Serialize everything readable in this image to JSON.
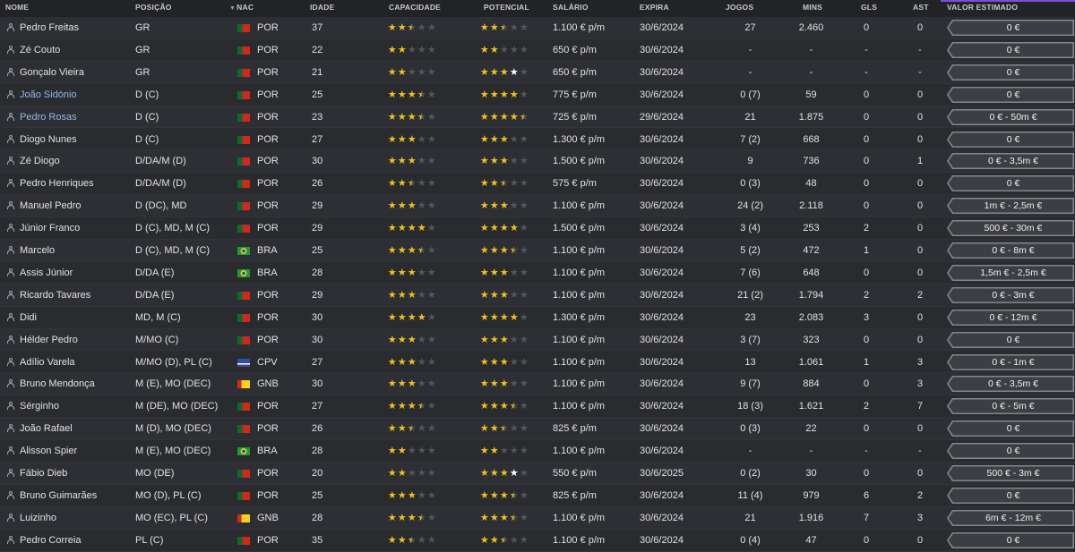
{
  "columns": {
    "name": "NOME",
    "position": "POSIÇÃO",
    "nationality": "NAC",
    "age": "IDADE",
    "ability": "CAPACIDADE",
    "potential": "POTENCIAL",
    "wage": "SALÁRIO",
    "expires": "EXPIRA",
    "games": "JOGOS",
    "minutes": "MINS",
    "goals": "GLS",
    "assists": "AST",
    "estimated_value": "VALOR ESTIMADO"
  },
  "sort_icon": "triangle-down-icon",
  "colors": {
    "star": "#f2c21b",
    "star_empty": "#55565b",
    "highlight_name": "#8fb8e6",
    "header_accent": "#7a4dd6"
  },
  "flags": {
    "POR": [
      "#0b6b2e",
      "#d3261c"
    ],
    "BRA": [
      "#1a9a3a",
      "#f5d21c"
    ],
    "CPV": [
      "#2a4fa6",
      "#ffffff"
    ],
    "GNB": [
      "#d3261c",
      "#f5d21c"
    ]
  },
  "players": [
    {
      "name": "Pedro Freitas",
      "position": "GR",
      "nat": "POR",
      "age": "37",
      "ability": 2.5,
      "potential": 2.5,
      "potential_white": 0,
      "wage": "1.100 € p/m",
      "expires": "30/6/2024",
      "games": "27",
      "mins": "2.460",
      "goals": "0",
      "assists": "0",
      "value": "0 €",
      "highlight": false
    },
    {
      "name": "Zé Couto",
      "position": "GR",
      "nat": "POR",
      "age": "22",
      "ability": 2,
      "potential": 2,
      "potential_white": 0,
      "wage": "650 € p/m",
      "expires": "30/6/2024",
      "games": "-",
      "mins": "-",
      "goals": "-",
      "assists": "-",
      "value": "0 €",
      "highlight": false
    },
    {
      "name": "Gonçalo Vieira",
      "position": "GR",
      "nat": "POR",
      "age": "21",
      "ability": 2,
      "potential": 3,
      "potential_white": 1,
      "wage": "650 € p/m",
      "expires": "30/6/2024",
      "games": "-",
      "mins": "-",
      "goals": "-",
      "assists": "-",
      "value": "0 €",
      "highlight": false
    },
    {
      "name": "João Sidónio",
      "position": "D (C)",
      "nat": "POR",
      "age": "25",
      "ability": 3.5,
      "potential": 4,
      "potential_white": 0,
      "wage": "775 € p/m",
      "expires": "30/6/2024",
      "games": "0 (7)",
      "mins": "59",
      "goals": "0",
      "assists": "0",
      "value": "0 €",
      "highlight": true
    },
    {
      "name": "Pedro Rosas",
      "position": "D (C)",
      "nat": "POR",
      "age": "23",
      "ability": 3.5,
      "potential": 4.5,
      "potential_white": 0,
      "wage": "725 € p/m",
      "expires": "29/6/2024",
      "games": "21",
      "mins": "1.875",
      "goals": "0",
      "assists": "0",
      "value": "0 € - 50m €",
      "highlight": true
    },
    {
      "name": "Diogo Nunes",
      "position": "D (C)",
      "nat": "POR",
      "age": "27",
      "ability": 3,
      "potential": 3,
      "potential_white": 0,
      "wage": "1.300 € p/m",
      "expires": "30/6/2024",
      "games": "7 (2)",
      "mins": "668",
      "goals": "0",
      "assists": "0",
      "value": "0 €",
      "highlight": false
    },
    {
      "name": "Zé Diogo",
      "position": "D/DA/M (D)",
      "nat": "POR",
      "age": "30",
      "ability": 3,
      "potential": 3,
      "potential_white": 0,
      "wage": "1.500 € p/m",
      "expires": "30/6/2024",
      "games": "9",
      "mins": "736",
      "goals": "0",
      "assists": "1",
      "value": "0 € - 3,5m €",
      "highlight": false
    },
    {
      "name": "Pedro Henriques",
      "position": "D/DA/M (D)",
      "nat": "POR",
      "age": "26",
      "ability": 2.5,
      "potential": 2.5,
      "potential_white": 0,
      "wage": "575 € p/m",
      "expires": "30/6/2024",
      "games": "0 (3)",
      "mins": "48",
      "goals": "0",
      "assists": "0",
      "value": "0 €",
      "highlight": false
    },
    {
      "name": "Manuel Pedro",
      "position": "D (DC), MD",
      "nat": "POR",
      "age": "29",
      "ability": 3,
      "potential": 3,
      "potential_white": 0,
      "wage": "1.100 € p/m",
      "expires": "30/6/2024",
      "games": "24 (2)",
      "mins": "2.118",
      "goals": "0",
      "assists": "0",
      "value": "1m € - 2,5m €",
      "highlight": false
    },
    {
      "name": "Júnior Franco",
      "position": "D (C), MD, M (C)",
      "nat": "POR",
      "age": "29",
      "ability": 4,
      "potential": 4,
      "potential_white": 0,
      "wage": "1.500 € p/m",
      "expires": "30/6/2024",
      "games": "3 (4)",
      "mins": "253",
      "goals": "2",
      "assists": "0",
      "value": "500 € - 30m €",
      "highlight": false
    },
    {
      "name": "Marcelo",
      "position": "D (C), MD, M (C)",
      "nat": "BRA",
      "age": "25",
      "ability": 3.5,
      "potential": 3.5,
      "potential_white": 0,
      "wage": "1.100 € p/m",
      "expires": "30/6/2024",
      "games": "5 (2)",
      "mins": "472",
      "goals": "1",
      "assists": "0",
      "value": "0 € - 8m €",
      "highlight": false
    },
    {
      "name": "Assis Júnior",
      "position": "D/DA (E)",
      "nat": "BRA",
      "age": "28",
      "ability": 3,
      "potential": 3,
      "potential_white": 0,
      "wage": "1.100 € p/m",
      "expires": "30/6/2024",
      "games": "7 (6)",
      "mins": "648",
      "goals": "0",
      "assists": "0",
      "value": "1,5m € - 2,5m €",
      "highlight": false
    },
    {
      "name": "Ricardo Tavares",
      "position": "D/DA (E)",
      "nat": "POR",
      "age": "29",
      "ability": 3,
      "potential": 3,
      "potential_white": 0,
      "wage": "1.100 € p/m",
      "expires": "30/6/2024",
      "games": "21 (2)",
      "mins": "1.794",
      "goals": "2",
      "assists": "2",
      "value": "0 € - 3m €",
      "highlight": false
    },
    {
      "name": "Didi",
      "position": "MD, M (C)",
      "nat": "POR",
      "age": "30",
      "ability": 4,
      "potential": 4,
      "potential_white": 0,
      "wage": "1.300 € p/m",
      "expires": "30/6/2024",
      "games": "23",
      "mins": "2.083",
      "goals": "3",
      "assists": "0",
      "value": "0 € - 12m €",
      "highlight": false
    },
    {
      "name": "Hélder Pedro",
      "position": "M/MO (C)",
      "nat": "POR",
      "age": "30",
      "ability": 3,
      "potential": 3,
      "potential_white": 0,
      "wage": "1.100 € p/m",
      "expires": "30/6/2024",
      "games": "3 (7)",
      "mins": "323",
      "goals": "0",
      "assists": "0",
      "value": "0 €",
      "highlight": false
    },
    {
      "name": "Adílio Varela",
      "position": "M/MO (D), PL (C)",
      "nat": "CPV",
      "age": "27",
      "ability": 3,
      "potential": 3,
      "potential_white": 0,
      "wage": "1.100 € p/m",
      "expires": "30/6/2024",
      "games": "13",
      "mins": "1.061",
      "goals": "1",
      "assists": "3",
      "value": "0 € - 1m €",
      "highlight": false
    },
    {
      "name": "Bruno Mendonça",
      "position": "M (E), MO (DEC)",
      "nat": "GNB",
      "age": "30",
      "ability": 3,
      "potential": 3,
      "potential_white": 0,
      "wage": "1.100 € p/m",
      "expires": "30/6/2024",
      "games": "9 (7)",
      "mins": "884",
      "goals": "0",
      "assists": "3",
      "value": "0 € - 3,5m €",
      "highlight": false
    },
    {
      "name": "Sérginho",
      "position": "M (DE), MO (DEC)",
      "nat": "POR",
      "age": "27",
      "ability": 3.5,
      "potential": 3.5,
      "potential_white": 0,
      "wage": "1.100 € p/m",
      "expires": "30/6/2024",
      "games": "18 (3)",
      "mins": "1.621",
      "goals": "2",
      "assists": "7",
      "value": "0 € - 5m €",
      "highlight": false
    },
    {
      "name": "João Rafael",
      "position": "M (D), MO (DEC)",
      "nat": "POR",
      "age": "26",
      "ability": 2.5,
      "potential": 2.5,
      "potential_white": 0,
      "wage": "825 € p/m",
      "expires": "30/6/2024",
      "games": "0 (3)",
      "mins": "22",
      "goals": "0",
      "assists": "0",
      "value": "0 €",
      "highlight": false
    },
    {
      "name": "Alisson Spier",
      "position": "M (E), MO (DEC)",
      "nat": "BRA",
      "age": "28",
      "ability": 2,
      "potential": 2,
      "potential_white": 0,
      "wage": "1.100 € p/m",
      "expires": "30/6/2024",
      "games": "-",
      "mins": "-",
      "goals": "-",
      "assists": "-",
      "value": "0 €",
      "highlight": false
    },
    {
      "name": "Fábio Dieb",
      "position": "MO (DE)",
      "nat": "POR",
      "age": "20",
      "ability": 2,
      "potential": 3,
      "potential_white": 1.5,
      "wage": "550 € p/m",
      "expires": "30/6/2025",
      "games": "0 (2)",
      "mins": "30",
      "goals": "0",
      "assists": "0",
      "value": "500 € - 3m €",
      "highlight": false
    },
    {
      "name": "Bruno Guimarães",
      "position": "MO (D), PL (C)",
      "nat": "POR",
      "age": "25",
      "ability": 3,
      "potential": 3.5,
      "potential_white": 0,
      "wage": "825 € p/m",
      "expires": "30/6/2024",
      "games": "11 (4)",
      "mins": "979",
      "goals": "6",
      "assists": "2",
      "value": "0 €",
      "highlight": false
    },
    {
      "name": "Luizinho",
      "position": "MO (EC), PL (C)",
      "nat": "GNB",
      "age": "28",
      "ability": 3.5,
      "potential": 3.5,
      "potential_white": 0,
      "wage": "1.100 € p/m",
      "expires": "30/6/2024",
      "games": "21",
      "mins": "1.916",
      "goals": "7",
      "assists": "3",
      "value": "6m € - 12m €",
      "highlight": false
    },
    {
      "name": "Pedro Correia",
      "position": "PL (C)",
      "nat": "POR",
      "age": "35",
      "ability": 2.5,
      "potential": 2.5,
      "potential_white": 0,
      "wage": "1.100 € p/m",
      "expires": "30/6/2024",
      "games": "0 (4)",
      "mins": "47",
      "goals": "0",
      "assists": "0",
      "value": "0 €",
      "highlight": false
    }
  ]
}
